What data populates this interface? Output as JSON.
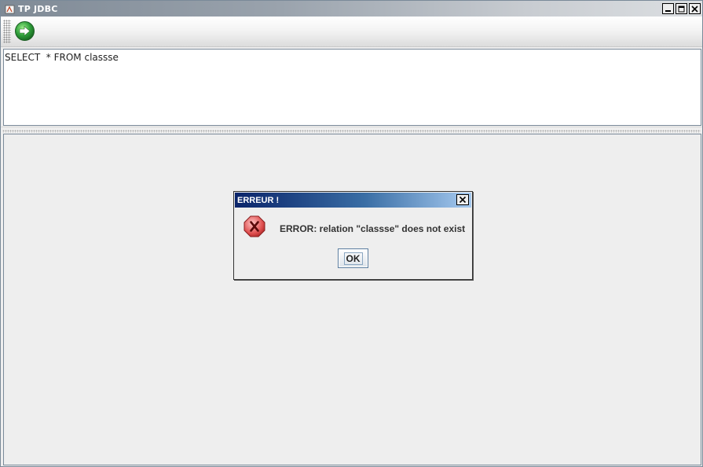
{
  "window": {
    "title": "TP JDBC",
    "controls": [
      "minimize",
      "maximize",
      "close"
    ]
  },
  "toolbar": {
    "run_icon": "arrow-right-circle-icon"
  },
  "query": {
    "value": "SELECT  * FROM classse"
  },
  "dialog": {
    "title": "ERREUR !",
    "icon": "error-icon",
    "message": "ERROR: relation \"classse\" does not exist",
    "ok_label": "OK"
  },
  "colors": {
    "dialog_title_start": "#0a246a",
    "dialog_title_end": "#a6caf0",
    "error_icon": "#e05050",
    "run_icon": "#2e9e3a"
  }
}
